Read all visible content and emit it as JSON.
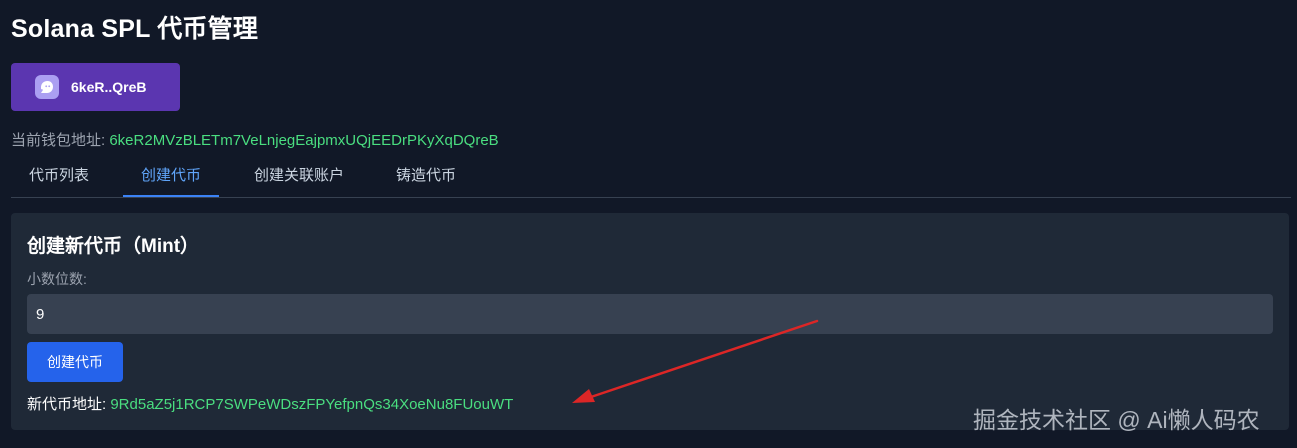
{
  "app": {
    "title": "Solana SPL 代币管理"
  },
  "wallet": {
    "button_label": "6keR..QreB",
    "address_label": "当前钱包地址:",
    "address": "6keR2MVzBLETm7VeLnjegEajpmxUQjEEDrPKyXqDQreB",
    "icon": "ghost-icon"
  },
  "tabs": [
    {
      "label": "代币列表",
      "active": false
    },
    {
      "label": "创建代币",
      "active": true
    },
    {
      "label": "创建关联账户",
      "active": false
    },
    {
      "label": "铸造代币",
      "active": false
    }
  ],
  "create_mint": {
    "title": "创建新代币（Mint）",
    "decimals_label": "小数位数:",
    "decimals_value": "9",
    "submit_label": "创建代币",
    "result_label": "新代币地址:",
    "result_address": "9Rd5aZ5j1RCP7SWPeWDszFPYefpnQs34XoeNu8FUouWT"
  },
  "watermark": "掘金技术社区 @ Ai懒人码农",
  "colors": {
    "background": "#111827",
    "panel": "#1f2937",
    "wallet_button": "#5b36b0",
    "primary_button": "#2563eb",
    "active_tab": "#60a5fa",
    "address": "#4ade80",
    "annotation_arrow": "#dc2626"
  }
}
